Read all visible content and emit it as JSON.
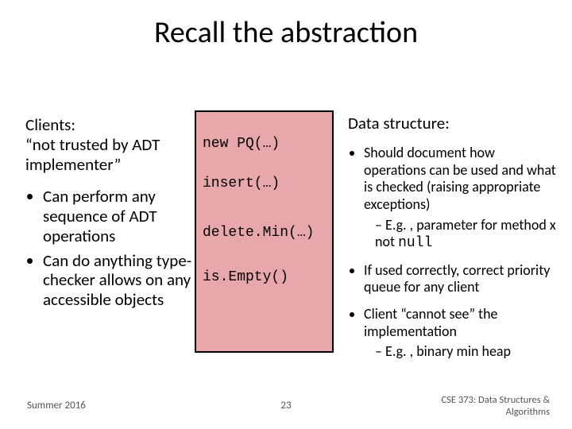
{
  "title": "Recall the abstraction",
  "left": {
    "intro": "Clients:\n“not trusted by ADT implementer”",
    "bullets": [
      "Can perform any sequence of ADT operations",
      "Can do anything type-checker allows on any accessible objects"
    ]
  },
  "box": {
    "ops": [
      "new PQ(…)",
      "insert(…)",
      "delete.Min(…)",
      "is.Empty()"
    ]
  },
  "right": {
    "title": "Data structure:",
    "bullets": [
      {
        "text_pre": "Should document how operations can be used and what is checked (raising appropriate exceptions)",
        "sub_pre": "E.g. , parameter for method x not ",
        "sub_code": "null"
      },
      {
        "text_pre": "If used correctly, correct priority queue for any client"
      },
      {
        "text_pre": "Client “cannot see” the implementation",
        "sub_pre": "E.g. , binary min heap"
      }
    ]
  },
  "footer": {
    "left": "Summer 2016",
    "center": "23",
    "right": "CSE 373: Data Structures & Algorithms"
  }
}
